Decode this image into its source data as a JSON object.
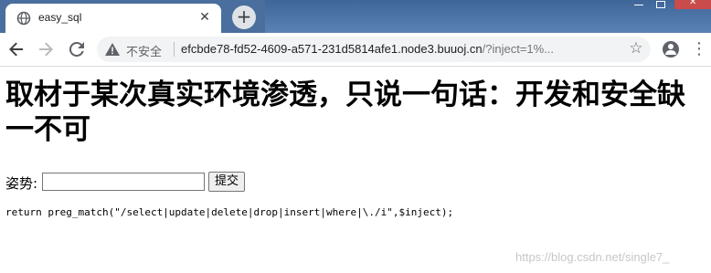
{
  "browser": {
    "tab_title": "easy_sql",
    "tab_close": "✕",
    "new_tab": "+",
    "window_close": "✕",
    "security_label": "不安全",
    "url_host": "efcbde78-fd52-4609-a571-231d5814afe1.node3.buuoj.cn",
    "url_path": "/?inject=1%...",
    "icons": [
      "globe-icon",
      "back-arrow-icon",
      "forward-arrow-icon",
      "reload-icon",
      "warning-icon",
      "star-icon",
      "profile-icon",
      "kebab-menu-icon"
    ]
  },
  "page": {
    "heading": "取材于某次真实环境渗透，只说一句话：开发和安全缺一不可",
    "form": {
      "label": "姿势:",
      "input_value": "",
      "submit_label": "提交"
    },
    "code": "return preg_match(\"/select|update|delete|drop|insert|where|\\./i\",$inject);",
    "watermark": "https://blog.csdn.net/single7_"
  }
}
